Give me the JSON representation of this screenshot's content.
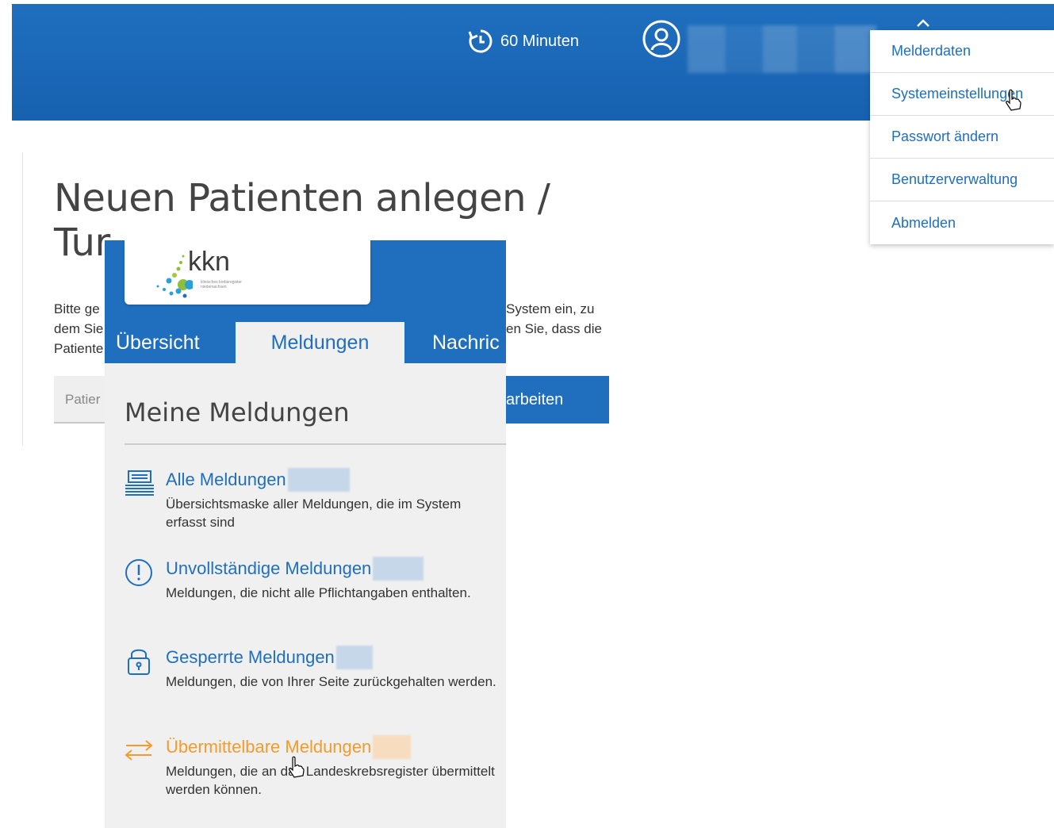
{
  "header": {
    "timer_label": "60 Minuten"
  },
  "user_menu": {
    "items": [
      {
        "label": "Melderdaten"
      },
      {
        "label": "Systemeinstellungen"
      },
      {
        "label": "Passwort ändern"
      },
      {
        "label": "Benutzerverwaltung"
      },
      {
        "label": "Abmelden"
      }
    ]
  },
  "page": {
    "title_line1": "Neuen Patienten anlegen /",
    "title_line2": "Tur",
    "text_lines": [
      "Bitte ge",
      "dem Sie",
      "Patiente"
    ],
    "text_right_lines": [
      "System ein, zu",
      "en Sie, dass die"
    ],
    "search_placeholder": "Patier",
    "button_label": "arbeiten"
  },
  "overlay": {
    "logo": {
      "name": "kkn",
      "subtitle": "klinisches krebsregister niedersachsen"
    },
    "tabs": [
      {
        "label": "Übersicht"
      },
      {
        "label": "Meldungen"
      },
      {
        "label": "Nachric"
      }
    ],
    "section_title": "Meine Meldungen",
    "entries": [
      {
        "icon": "stack-icon",
        "title": "Alle Meldungen",
        "desc": "Übersichtsmaske aller Meldungen, die im System erfasst sind",
        "color": "#1f6fbe"
      },
      {
        "icon": "exclamation-circle-icon",
        "title": "Unvollständige Meldungen",
        "desc": "Meldungen, die nicht alle Pflichtangaben enthalten.",
        "color": "#1f6fbe"
      },
      {
        "icon": "lock-icon",
        "title": "Gesperrte Meldungen",
        "desc": "Meldungen, die von Ihrer Seite zurückgehalten werden.",
        "color": "#1f6fbe"
      },
      {
        "icon": "transfer-arrows-icon",
        "title": "Übermittelbare Meldungen",
        "desc": "Meldungen, die an das Landeskrebsregister übermittelt werden können.",
        "color": "#f59a2b"
      }
    ]
  },
  "colors": {
    "primary": "#1f6fbe",
    "accent_orange": "#f59a2b",
    "panel_bg": "#f0f0f0"
  }
}
